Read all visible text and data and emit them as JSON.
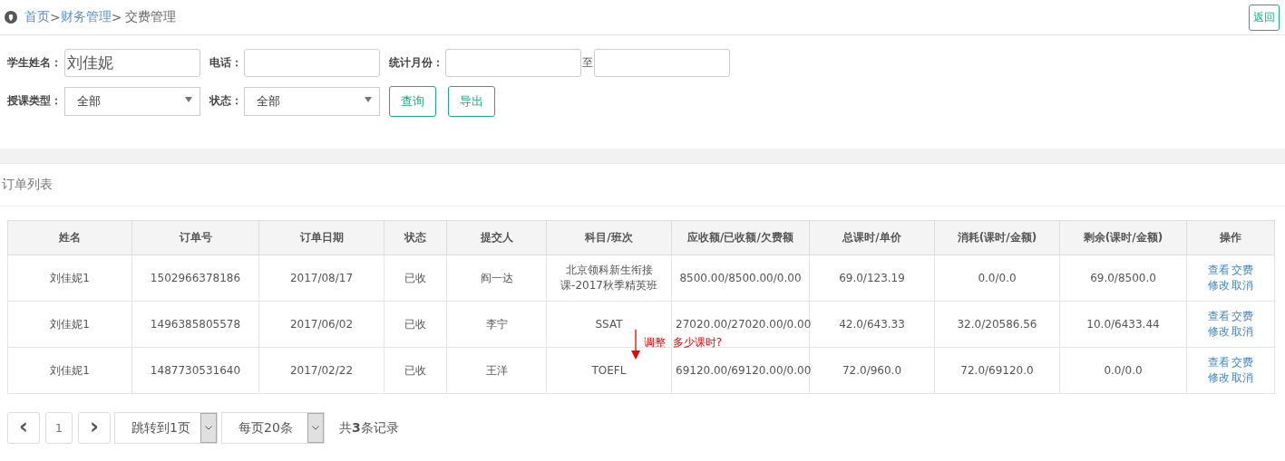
{
  "breadcrumb": {
    "home": "首页",
    "separator_1": ">",
    "section": "财务管理",
    "separator_2": ">",
    "current": "交费管理"
  },
  "back_button": "返回",
  "filters": [
    {
      "kind": "input",
      "label": "学生姓名：",
      "value": "刘佳妮"
    },
    {
      "kind": "input",
      "label": "电话："
    },
    {
      "kind": "range",
      "label": "统计月份：",
      "separator": "至"
    },
    {
      "kind": "select",
      "label": "授课类型：",
      "value": "全部"
    },
    {
      "kind": "select",
      "label": "状态：",
      "value": "全部"
    }
  ],
  "filter_buttons": [
    "查询",
    "导出"
  ],
  "panel_title": "订单列表",
  "table": {
    "columns": [
      "姓名",
      "订单号",
      "订单日期",
      "状态",
      "提交人",
      "科目/班次",
      "应收额/已收额/欠费额",
      "总课时/单价",
      "消耗(课时/金额)",
      "剩余(课时/金额)",
      "操作"
    ],
    "rows": [
      {
        "cells": [
          "刘佳妮1",
          "1502966378186",
          "2017/08/17",
          "已收",
          "阎一达",
          "北京领科新生衔接课-2017秋季精英班",
          "8500.00/8500.00/0.00",
          "69.0/123.19",
          "0.0/0.0",
          "69.0/8500.0"
        ],
        "actions": [
          "查看",
          "交费",
          "修改",
          "取消"
        ]
      },
      {
        "cells": [
          "刘佳妮1",
          "1496385805578",
          "2017/06/02",
          "已收",
          "李宁",
          "SSAT",
          "27020.00/27020.00/0.00",
          "42.0/643.33",
          "32.0/20586.56",
          "10.0/6433.44"
        ],
        "actions": [
          "查看",
          "交费",
          "修改",
          "取消"
        ]
      },
      {
        "cells": [
          "刘佳妮1",
          "1487730531640",
          "2017/02/22",
          "已收",
          "王洋",
          "TOEFL",
          "69120.00/69120.00/0.00",
          "72.0/960.0",
          "72.0/69120.0",
          "0.0/0.0"
        ],
        "actions": [
          "查看",
          "交费",
          "修改",
          "取消"
        ]
      }
    ]
  },
  "annotation": "调整  多少课时?",
  "pagination": {
    "prev": "‹",
    "page": "1",
    "next": "›",
    "jump": "跳转到1页",
    "page_size": "每页20条",
    "total": "共**3**条记录"
  }
}
